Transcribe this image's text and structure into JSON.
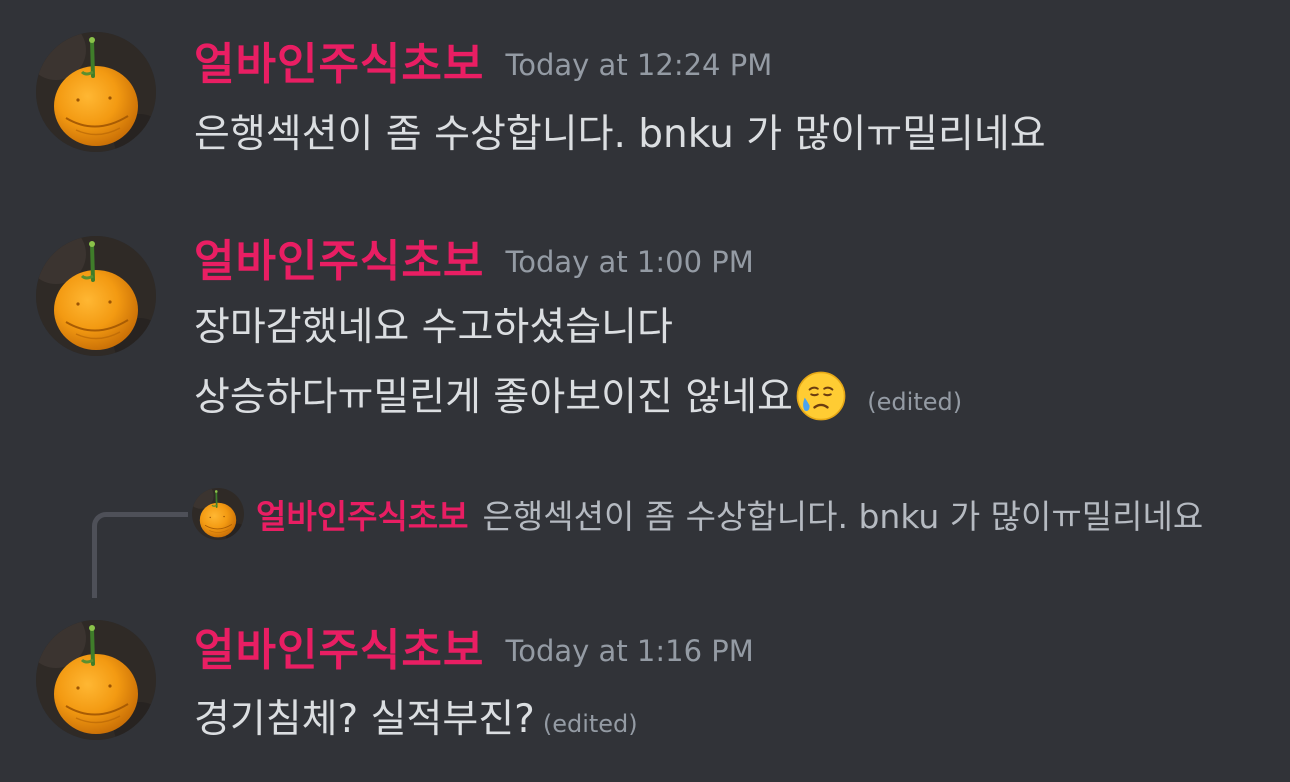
{
  "author": "얼바인주식초보",
  "messages": [
    {
      "timestamp": "Today at 12:24 PM",
      "lines": [
        "은행섹션이 좀 수상합니다. bnku 가 많이ㅠ밀리네요"
      ]
    },
    {
      "timestamp": "Today at 1:00 PM",
      "lines": [
        "장마감했네요 수고하셨습니다",
        "상승하다ㅠ밀린게 좋아보이진 않네요"
      ],
      "edited": "(edited)",
      "emoji": "sad-but-relieved-face"
    },
    {
      "reply": {
        "author": "얼바인주식초보",
        "text": "은행섹션이 좀 수상합니다. bnku 가 많이ㅠ밀리네요"
      },
      "timestamp": "Today at 1:16 PM",
      "lines": [
        "경기침체? 실적부진?"
      ],
      "edited": "(edited)"
    }
  ],
  "colors": {
    "background": "#313338",
    "username": "#e91e63",
    "text": "#dbdee1",
    "muted": "#949ba4"
  }
}
